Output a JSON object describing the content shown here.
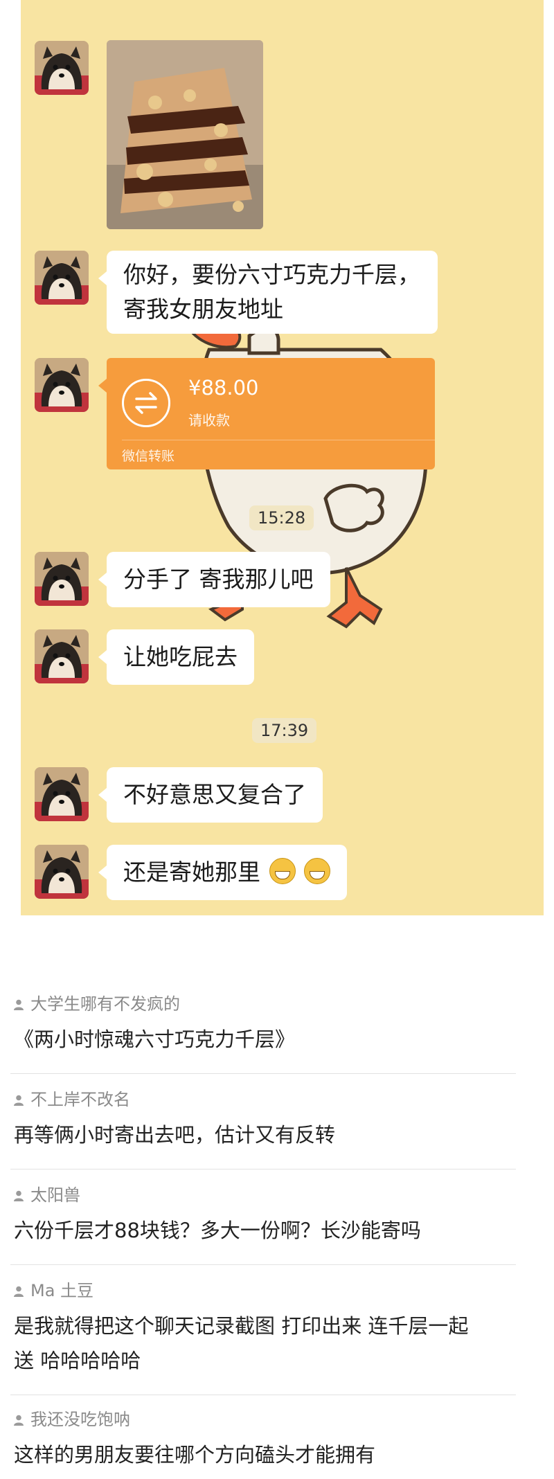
{
  "chat": {
    "messages": [
      {
        "type": "image",
        "alt": "chocolate crepe cake photo"
      },
      {
        "type": "text",
        "lines": [
          "你好，要份六寸巧克力千层，",
          "寄我女朋友地址"
        ]
      },
      {
        "type": "transfer",
        "amount": "¥88.00",
        "status": "请收款",
        "footer": "微信转账"
      },
      {
        "type": "time",
        "text": "15:28"
      },
      {
        "type": "text",
        "text": "分手了 寄我那儿吧"
      },
      {
        "type": "text",
        "text": "让她吃屁去"
      },
      {
        "type": "time",
        "text": "17:39"
      },
      {
        "type": "text",
        "text": "不好意思又复合了"
      },
      {
        "type": "text",
        "text": "还是寄她那里"
      }
    ],
    "colors": {
      "background": "#f8e4a2",
      "transfer": "#f69c3d",
      "bubble": "#ffffff"
    }
  },
  "comments": [
    {
      "user": "大学生哪有不发疯的",
      "text": "《两小时惊魂六寸巧克力千层》"
    },
    {
      "user": "不上岸不改名",
      "text": "再等俩小时寄出去吧，估计又有反转"
    },
    {
      "user": "太阳兽",
      "text": "六份千层才88块钱？多大一份啊？长沙能寄吗"
    },
    {
      "user": "Ma 土豆",
      "text_lines": [
        "是我就得把这个聊天记录截图 打印出来 连千层一起",
        "送 哈哈哈哈哈"
      ]
    },
    {
      "user": "我还没吃饱呐",
      "text": "这样的男朋友要往哪个方向磕头才能拥有"
    }
  ]
}
